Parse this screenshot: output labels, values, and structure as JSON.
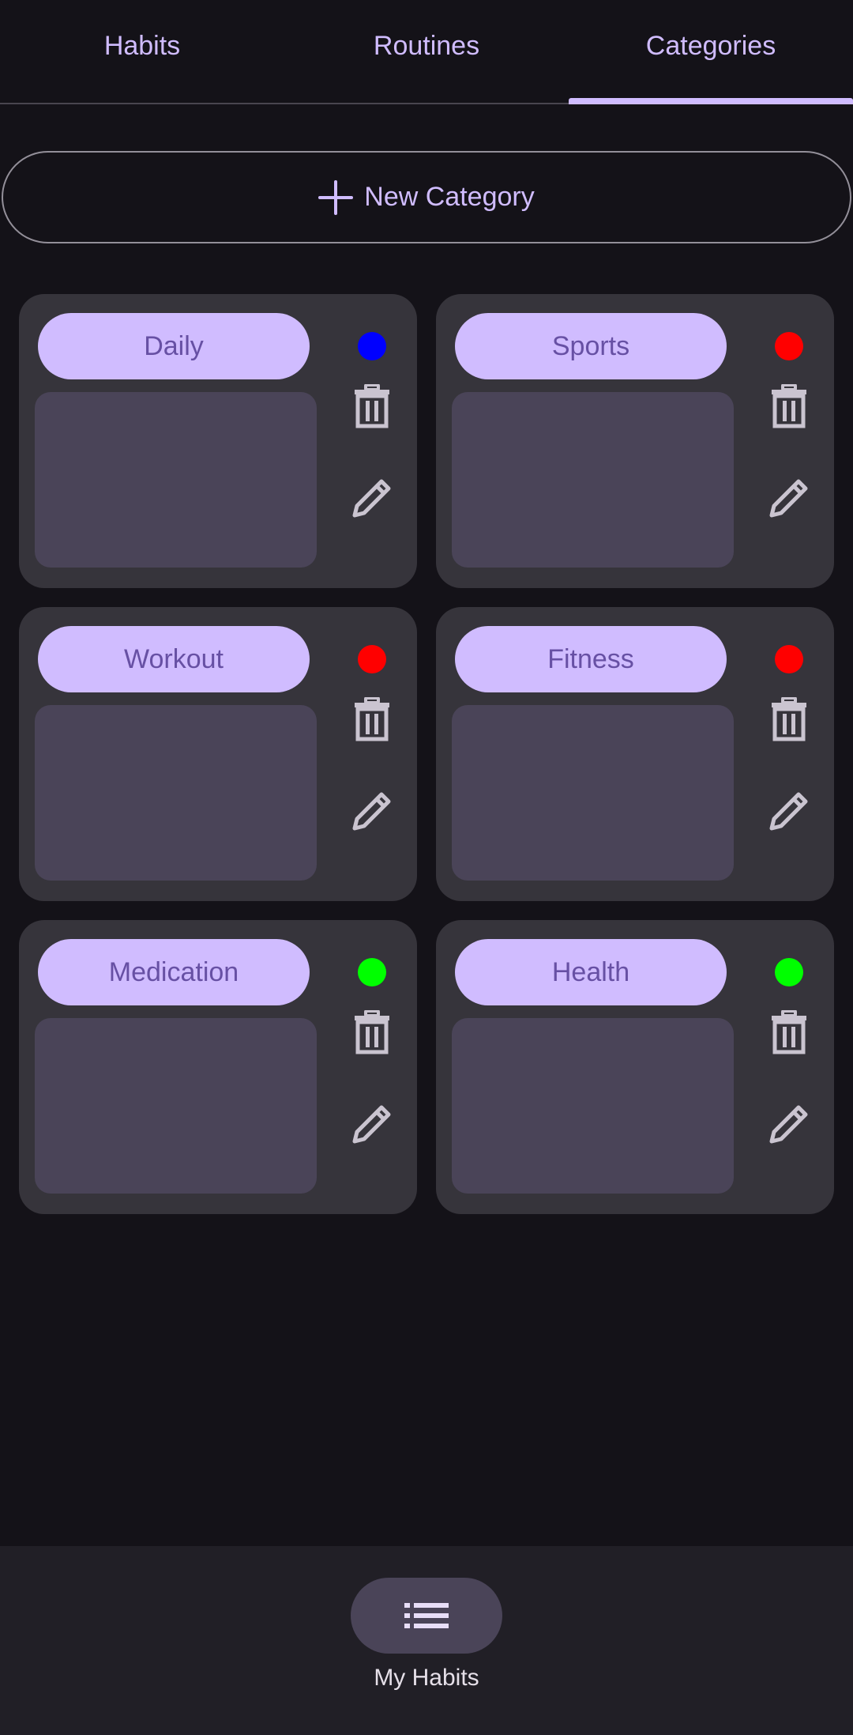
{
  "tabs": [
    {
      "label": "Habits",
      "active": false
    },
    {
      "label": "Routines",
      "active": false
    },
    {
      "label": "Categories",
      "active": true
    }
  ],
  "new_category_button": {
    "label": "New Category",
    "icon": "plus-icon"
  },
  "categories": [
    {
      "name": "Daily",
      "color": "#0000ff"
    },
    {
      "name": "Sports",
      "color": "#ff0000"
    },
    {
      "name": "Workout",
      "color": "#ff0000"
    },
    {
      "name": "Fitness",
      "color": "#ff0000"
    },
    {
      "name": "Medication",
      "color": "#00ff00"
    },
    {
      "name": "Health",
      "color": "#00ff00"
    }
  ],
  "card_icons": {
    "delete": "trash-icon",
    "edit": "pencil-icon"
  },
  "bottom_nav": {
    "label": "My Habits",
    "icon": "list-icon"
  },
  "colors": {
    "background": "#141218",
    "accent": "#d0bcff",
    "card": "#36343b",
    "card_body": "#4a4458",
    "nav_background": "#211f26"
  }
}
